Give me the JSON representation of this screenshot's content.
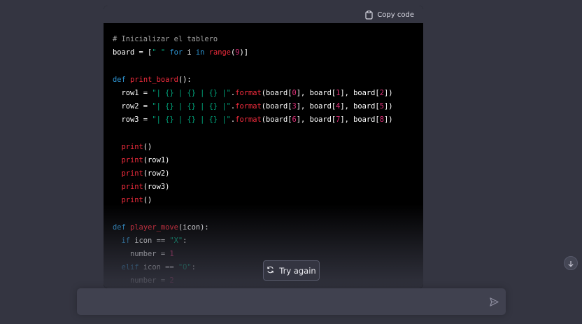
{
  "code_block": {
    "copy_label": "Copy code",
    "lines": [
      [
        {
          "t": "# Inicializar el tablero",
          "c": "comment"
        }
      ],
      [
        {
          "t": "board = [",
          "c": ""
        },
        {
          "t": "\" \"",
          "c": "str"
        },
        {
          "t": " ",
          "c": ""
        },
        {
          "t": "for",
          "c": "kw"
        },
        {
          "t": " i ",
          "c": ""
        },
        {
          "t": "in",
          "c": "kw"
        },
        {
          "t": " ",
          "c": ""
        },
        {
          "t": "range",
          "c": "fn"
        },
        {
          "t": "(",
          "c": ""
        },
        {
          "t": "9",
          "c": "num"
        },
        {
          "t": ")]",
          "c": ""
        }
      ],
      [
        {
          "t": "",
          "c": ""
        }
      ],
      [
        {
          "t": "def",
          "c": "kw"
        },
        {
          "t": " ",
          "c": ""
        },
        {
          "t": "print_board",
          "c": "fn"
        },
        {
          "t": "():",
          "c": ""
        }
      ],
      [
        {
          "t": "  row1 = ",
          "c": ""
        },
        {
          "t": "\"| {} | {} | {} |\"",
          "c": "str"
        },
        {
          "t": ".",
          "c": ""
        },
        {
          "t": "format",
          "c": "fn"
        },
        {
          "t": "(board[",
          "c": ""
        },
        {
          "t": "0",
          "c": "num"
        },
        {
          "t": "], board[",
          "c": ""
        },
        {
          "t": "1",
          "c": "num"
        },
        {
          "t": "], board[",
          "c": ""
        },
        {
          "t": "2",
          "c": "num"
        },
        {
          "t": "])",
          "c": ""
        }
      ],
      [
        {
          "t": "  row2 = ",
          "c": ""
        },
        {
          "t": "\"| {} | {} | {} |\"",
          "c": "str"
        },
        {
          "t": ".",
          "c": ""
        },
        {
          "t": "format",
          "c": "fn"
        },
        {
          "t": "(board[",
          "c": ""
        },
        {
          "t": "3",
          "c": "num"
        },
        {
          "t": "], board[",
          "c": ""
        },
        {
          "t": "4",
          "c": "num"
        },
        {
          "t": "], board[",
          "c": ""
        },
        {
          "t": "5",
          "c": "num"
        },
        {
          "t": "])",
          "c": ""
        }
      ],
      [
        {
          "t": "  row3 = ",
          "c": ""
        },
        {
          "t": "\"| {} | {} | {} |\"",
          "c": "str"
        },
        {
          "t": ".",
          "c": ""
        },
        {
          "t": "format",
          "c": "fn"
        },
        {
          "t": "(board[",
          "c": ""
        },
        {
          "t": "6",
          "c": "num"
        },
        {
          "t": "], board[",
          "c": ""
        },
        {
          "t": "7",
          "c": "num"
        },
        {
          "t": "], board[",
          "c": ""
        },
        {
          "t": "8",
          "c": "num"
        },
        {
          "t": "])",
          "c": ""
        }
      ],
      [
        {
          "t": "",
          "c": ""
        }
      ],
      [
        {
          "t": "  ",
          "c": ""
        },
        {
          "t": "print",
          "c": "fn"
        },
        {
          "t": "()",
          "c": ""
        }
      ],
      [
        {
          "t": "  ",
          "c": ""
        },
        {
          "t": "print",
          "c": "fn"
        },
        {
          "t": "(row1)",
          "c": ""
        }
      ],
      [
        {
          "t": "  ",
          "c": ""
        },
        {
          "t": "print",
          "c": "fn"
        },
        {
          "t": "(row2)",
          "c": ""
        }
      ],
      [
        {
          "t": "  ",
          "c": ""
        },
        {
          "t": "print",
          "c": "fn"
        },
        {
          "t": "(row3)",
          "c": ""
        }
      ],
      [
        {
          "t": "  ",
          "c": ""
        },
        {
          "t": "print",
          "c": "fn"
        },
        {
          "t": "()",
          "c": ""
        }
      ],
      [
        {
          "t": "",
          "c": ""
        }
      ],
      [
        {
          "t": "def",
          "c": "kw"
        },
        {
          "t": " ",
          "c": ""
        },
        {
          "t": "player_move",
          "c": "fn"
        },
        {
          "t": "(icon):",
          "c": ""
        }
      ],
      [
        {
          "t": "  ",
          "c": ""
        },
        {
          "t": "if",
          "c": "kw"
        },
        {
          "t": " icon == ",
          "c": ""
        },
        {
          "t": "\"X\"",
          "c": "str"
        },
        {
          "t": ":",
          "c": ""
        }
      ],
      [
        {
          "t": "    number = ",
          "c": ""
        },
        {
          "t": "1",
          "c": "num"
        }
      ],
      [
        {
          "t": "  ",
          "c": ""
        },
        {
          "t": "elif",
          "c": "kw"
        },
        {
          "t": " icon == ",
          "c": ""
        },
        {
          "t": "\"O\"",
          "c": "str"
        },
        {
          "t": ":",
          "c": ""
        }
      ],
      [
        {
          "t": "    number = ",
          "c": ""
        },
        {
          "t": "2",
          "c": "num"
        }
      ]
    ]
  },
  "try_again": {
    "label": "Try again",
    "icon": "refresh-icon"
  },
  "scroll_down": {
    "icon": "arrow-down-icon"
  },
  "composer": {
    "placeholder": "",
    "value": "",
    "send_icon": "send-icon"
  },
  "colors": {
    "background": "#343541",
    "code_bg": "#000000",
    "keyword": "#2e95d3",
    "function": "#f22c3d",
    "string": "#00a67d",
    "number": "#df3079",
    "comment": "#a0a0a0"
  }
}
